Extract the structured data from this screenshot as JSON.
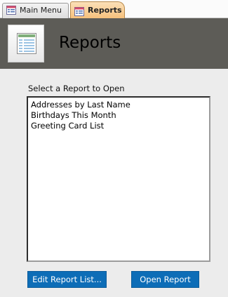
{
  "tabs": [
    {
      "label": "Main Menu",
      "icon": "form-icon",
      "active": false
    },
    {
      "label": "Reports",
      "icon": "form-icon",
      "active": true
    }
  ],
  "header": {
    "title": "Reports",
    "icon": "report-icon"
  },
  "report_list": {
    "prompt": "Select a Report to Open",
    "items": [
      "Addresses by Last Name",
      "Birthdays This Month",
      "Greeting Card List"
    ]
  },
  "buttons": {
    "edit_label": "Edit Report List...",
    "open_label": "Open Report"
  },
  "colors": {
    "header_bg": "#5d5c57",
    "active_tab": "#f6c07a",
    "button_bg": "#0d6db7"
  }
}
